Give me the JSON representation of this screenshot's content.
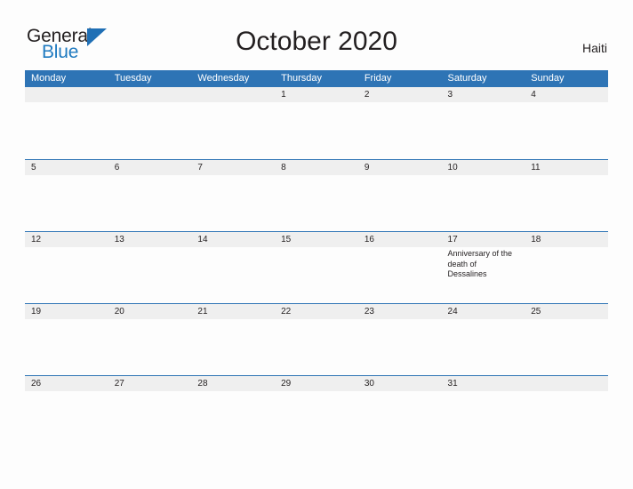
{
  "brand": {
    "name_part1": "General",
    "name_part2": "Blue",
    "triangle_color": "#1f6fb5"
  },
  "header": {
    "title": "October 2020",
    "region": "Haiti"
  },
  "calendar": {
    "month": "October",
    "year": "2020",
    "header_color": "#2e74b5",
    "date_strip_color": "#efefef",
    "weekdays": [
      "Monday",
      "Tuesday",
      "Wednesday",
      "Thursday",
      "Friday",
      "Saturday",
      "Sunday"
    ],
    "weeks": [
      {
        "days": [
          {
            "date": "",
            "event": ""
          },
          {
            "date": "",
            "event": ""
          },
          {
            "date": "",
            "event": ""
          },
          {
            "date": "1",
            "event": ""
          },
          {
            "date": "2",
            "event": ""
          },
          {
            "date": "3",
            "event": ""
          },
          {
            "date": "4",
            "event": ""
          }
        ]
      },
      {
        "days": [
          {
            "date": "5",
            "event": ""
          },
          {
            "date": "6",
            "event": ""
          },
          {
            "date": "7",
            "event": ""
          },
          {
            "date": "8",
            "event": ""
          },
          {
            "date": "9",
            "event": ""
          },
          {
            "date": "10",
            "event": ""
          },
          {
            "date": "11",
            "event": ""
          }
        ]
      },
      {
        "days": [
          {
            "date": "12",
            "event": ""
          },
          {
            "date": "13",
            "event": ""
          },
          {
            "date": "14",
            "event": ""
          },
          {
            "date": "15",
            "event": ""
          },
          {
            "date": "16",
            "event": ""
          },
          {
            "date": "17",
            "event": "Anniversary of the death of Dessalines"
          },
          {
            "date": "18",
            "event": ""
          }
        ]
      },
      {
        "days": [
          {
            "date": "19",
            "event": ""
          },
          {
            "date": "20",
            "event": ""
          },
          {
            "date": "21",
            "event": ""
          },
          {
            "date": "22",
            "event": ""
          },
          {
            "date": "23",
            "event": ""
          },
          {
            "date": "24",
            "event": ""
          },
          {
            "date": "25",
            "event": ""
          }
        ]
      },
      {
        "days": [
          {
            "date": "26",
            "event": ""
          },
          {
            "date": "27",
            "event": ""
          },
          {
            "date": "28",
            "event": ""
          },
          {
            "date": "29",
            "event": ""
          },
          {
            "date": "30",
            "event": ""
          },
          {
            "date": "31",
            "event": ""
          },
          {
            "date": "",
            "event": ""
          }
        ]
      }
    ]
  }
}
